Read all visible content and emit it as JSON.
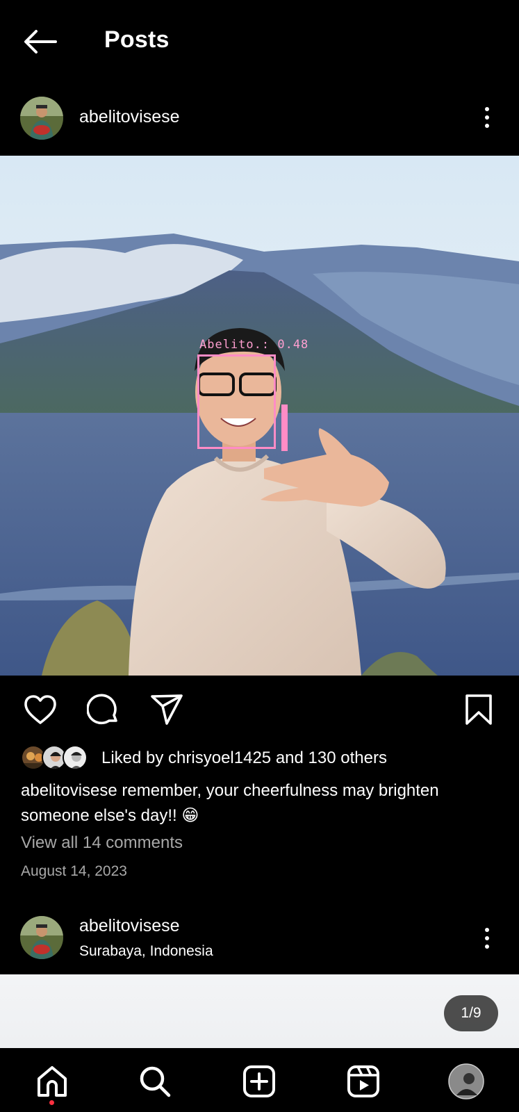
{
  "header": {
    "title": "Posts"
  },
  "post": {
    "username": "abelitovisese",
    "face_label": "Abelito.: 0.48",
    "likes_text": "Liked by chrisyoel1425 and 130 others",
    "caption": "abelitovisese remember, your cheerfulness may brighten someone else's day!! 😁",
    "view_comments": "View all 14 comments",
    "date": "August 14, 2023"
  },
  "next_post": {
    "username": "abelitovisese",
    "location": "Surabaya, Indonesia",
    "counter": "1/9"
  },
  "colors": {
    "background": "#000000",
    "secondary_text": "#a8a8a8",
    "face_box": "#ff8cc6",
    "notification_dot": "#ff3040"
  },
  "icons": {
    "header": [
      "back-arrow-icon"
    ],
    "actions": [
      "heart-icon",
      "comment-icon",
      "share-icon",
      "bookmark-icon"
    ],
    "tabs": [
      "home-icon",
      "search-icon",
      "create-icon",
      "reels-icon",
      "profile-avatar"
    ]
  }
}
